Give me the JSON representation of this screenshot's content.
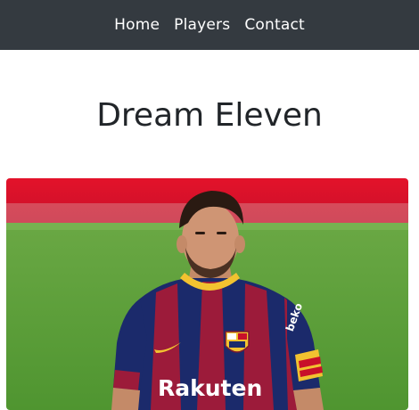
{
  "nav": {
    "items": [
      {
        "label": "Home"
      },
      {
        "label": "Players"
      },
      {
        "label": "Contact"
      }
    ]
  },
  "page": {
    "title": "Dream Eleven"
  },
  "player_card": {
    "shirt_sponsor": "Rakuten",
    "sleeve_logo": "beko"
  },
  "colors": {
    "navbar_bg": "#343a40",
    "nav_text": "#ffffff",
    "title_text": "#212529",
    "pitch_green": "#5ea23a",
    "stand_red": "#e3122a",
    "shirt_blue": "#1b2a6b",
    "shirt_red": "#9c1b3a",
    "collar_yellow": "#f2c230"
  }
}
